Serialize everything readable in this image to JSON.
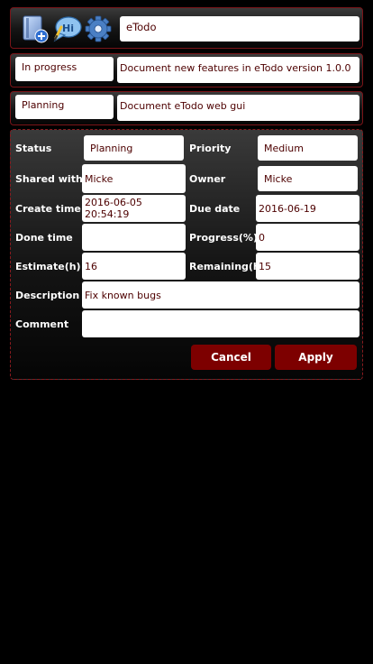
{
  "toolbar": {
    "icons": [
      "new-document-icon",
      "chat-bubble-icon",
      "gear-icon"
    ],
    "title_value": "eTodo"
  },
  "tasks": [
    {
      "status": "In progress",
      "name": "Document new features in eTodo version 1.0.0"
    },
    {
      "status": "Planning",
      "name": "Document eTodo web gui"
    }
  ],
  "details": {
    "status_label": "Status",
    "status_value": "Planning",
    "priority_label": "Priority",
    "priority_value": "Medium",
    "shared_label": "Shared with",
    "shared_value": "Micke",
    "owner_label": "Owner",
    "owner_value": "Micke",
    "create_label": "Create time",
    "create_value": "2016-06-05 20:54:19",
    "due_label": "Due date",
    "due_value": "2016-06-19",
    "done_label": "Done time",
    "done_value": "",
    "progress_label": "Progress(%)",
    "progress_value": "0",
    "estimate_label": "Estimate(h)",
    "estimate_value": "16",
    "remaining_label": "Remaining(h)",
    "remaining_value": "15",
    "description_label": "Description",
    "description_value": "Fix known bugs",
    "comment_label": "Comment",
    "comment_value": ""
  },
  "buttons": {
    "cancel": "Cancel",
    "apply": "Apply"
  },
  "colors": {
    "accent": "#7d0000",
    "border": "#7a1418",
    "text_dark": "#4d0000"
  }
}
